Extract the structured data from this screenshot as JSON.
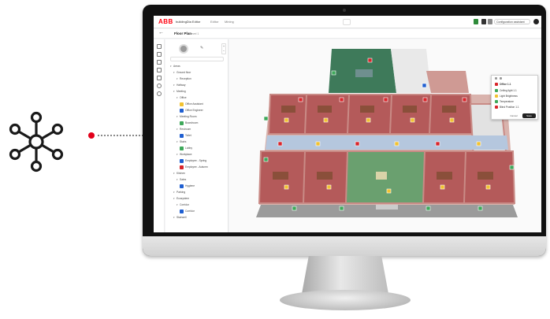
{
  "app": {
    "logo_text": "ABB",
    "title": "buildingDia Editor",
    "nav": [
      "Editor",
      "Mining"
    ],
    "profile": "Configuration assistant",
    "floor_title": "Floor Plan",
    "floor_sub": "Level 1"
  },
  "tree": {
    "rows": [
      {
        "label": "Areas",
        "indent": 0
      },
      {
        "label": "Ground floor",
        "indent": 1
      },
      {
        "label": "Reception",
        "indent": 2
      },
      {
        "label": "Hallway",
        "indent": 1
      },
      {
        "label": "Meeting",
        "indent": 1
      },
      {
        "label": "Office",
        "indent": 2
      },
      {
        "label": "Office Assistant",
        "indent": 3
      },
      {
        "label": "Office Engineer",
        "indent": 3
      },
      {
        "label": "Meeting Room",
        "indent": 2
      },
      {
        "label": "Boardroom",
        "indent": 3
      },
      {
        "label": "Restroom",
        "indent": 2
      },
      {
        "label": "Toilet",
        "indent": 3
      },
      {
        "label": "Stairs",
        "indent": 2
      },
      {
        "label": "Lobby",
        "indent": 3
      },
      {
        "label": "Workplace",
        "indent": 2
      },
      {
        "label": "Employee - Spring",
        "indent": 3
      },
      {
        "label": "Employee - Autumn",
        "indent": 3
      },
      {
        "label": "Kitchen",
        "indent": 1
      },
      {
        "label": "Sales",
        "indent": 2
      },
      {
        "label": "Hygiene",
        "indent": 3
      },
      {
        "label": "Parking",
        "indent": 1
      },
      {
        "label": "Ecosystem",
        "indent": 1
      },
      {
        "label": "Corridor",
        "indent": 2
      },
      {
        "label": "Corridor",
        "indent": 3
      },
      {
        "label": "Stairwell",
        "indent": 1
      }
    ]
  },
  "popup": {
    "title": "Office 1.1",
    "rows": [
      "Ceiling light 1.1",
      "Light Brightness",
      "Temperature",
      "Blind Position 1.1"
    ],
    "cancel": "Cancel",
    "ok": "Save"
  },
  "colors": {
    "brand": "#ff000f",
    "room_wall": "#a35a5a",
    "floor_red": "#b45a5a",
    "meeting_green": "#3e7a5a",
    "device_yellow": "#f2c230",
    "device_green": "#3ea85a",
    "device_red": "#d8242a"
  }
}
